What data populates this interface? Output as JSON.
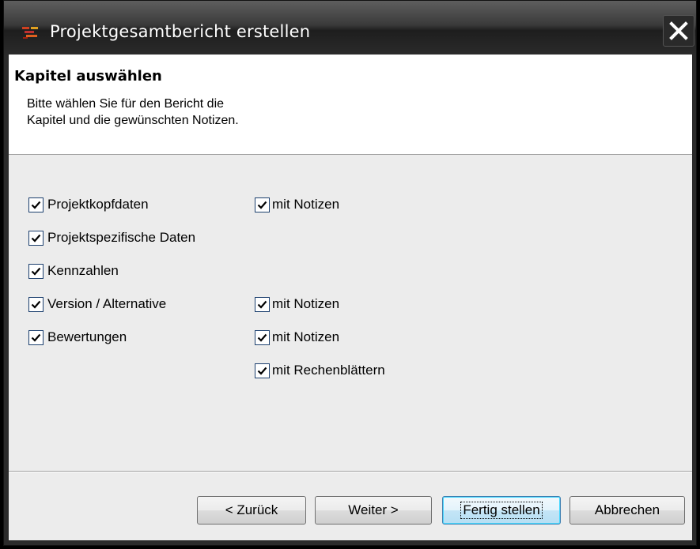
{
  "window": {
    "title": "Projektgesamtbericht erstellen",
    "close_label": "Close"
  },
  "header": {
    "title": "Kapitel auswählen",
    "description_line1": "Bitte wählen Sie für den Bericht die",
    "description_line2": "Kapitel und die gewünschten Notizen."
  },
  "options": [
    {
      "label": "Projektkopfdaten",
      "checked": true
    },
    {
      "label": "Projektspezifische Daten",
      "checked": true
    },
    {
      "label": "Kennzahlen",
      "checked": true
    },
    {
      "label": "Version / Alternative",
      "checked": true
    },
    {
      "label": "Bewertungen",
      "checked": true
    }
  ],
  "sub_options": [
    {
      "label": "mit Notizen",
      "checked": true
    },
    {
      "label": "mit Notizen",
      "checked": true
    },
    {
      "label": "mit Notizen",
      "checked": true
    },
    {
      "label": "mit Rechenblättern",
      "checked": true
    }
  ],
  "buttons": {
    "back": "< Zurück",
    "next": "Weiter >",
    "finish": "Fertig stellen",
    "cancel": "Abbrechen"
  },
  "colors": {
    "title_bar": "#2b2b2b",
    "dialog_bg": "#ececec",
    "checkbox_border": "#1c3f6e"
  }
}
